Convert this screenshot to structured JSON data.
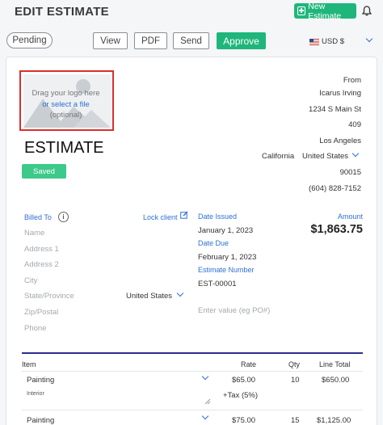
{
  "header": {
    "title": "EDIT ESTIMATE",
    "new_estimate_label": "New Estimate"
  },
  "actions": {
    "status": "Pending",
    "view": "View",
    "pdf": "PDF",
    "send": "Send",
    "approve": "Approve",
    "currency": "USD $"
  },
  "logo": {
    "line1": "Drag your logo here",
    "line2": "or select a file",
    "line3": "(optional)"
  },
  "document": {
    "title": "ESTIMATE",
    "badge": "Saved"
  },
  "from": {
    "label": "From",
    "name": "Icarus Irving",
    "address": "1234 S Main St",
    "unit": "409",
    "city": "Los Angeles",
    "state": "California",
    "country": "United States",
    "zip": "90015",
    "phone": "(604) 828-7152"
  },
  "billed_to": {
    "label": "Billed To",
    "lock_label": "Lock client",
    "name_ph": "Name",
    "address1_ph": "Address 1",
    "address2_ph": "Address 2",
    "city_ph": "City",
    "state_ph": "State/Province",
    "country": "United States",
    "zip_ph": "Zip/Postal",
    "phone_ph": "Phone"
  },
  "meta": {
    "date_issued_label": "Date Issued",
    "date_issued": "January 1, 2023",
    "date_due_label": "Date Due",
    "date_due": "February 1, 2023",
    "number_label": "Estimate Number",
    "number": "EST-00001",
    "po_ph": "Enter value (eg PO#)",
    "amount_label": "Amount",
    "amount": "$1,863.75"
  },
  "table": {
    "headers": {
      "item": "Item",
      "rate": "Rate",
      "qty": "Qty",
      "total": "Line Total"
    },
    "rows": [
      {
        "item": "Painting",
        "desc": "Interior",
        "rate": "$65.00",
        "qty": "10",
        "total": "$650.00",
        "tax": "+Tax (5%)"
      },
      {
        "item": "Painting",
        "desc": "",
        "rate": "$75.00",
        "qty": "15",
        "total": "$1,125.00",
        "tax": ""
      }
    ]
  },
  "colors": {
    "accent": "#1fb67b",
    "link": "#2f6fd6",
    "divider": "#2b2f8a",
    "logo_border": "#d9302c"
  }
}
